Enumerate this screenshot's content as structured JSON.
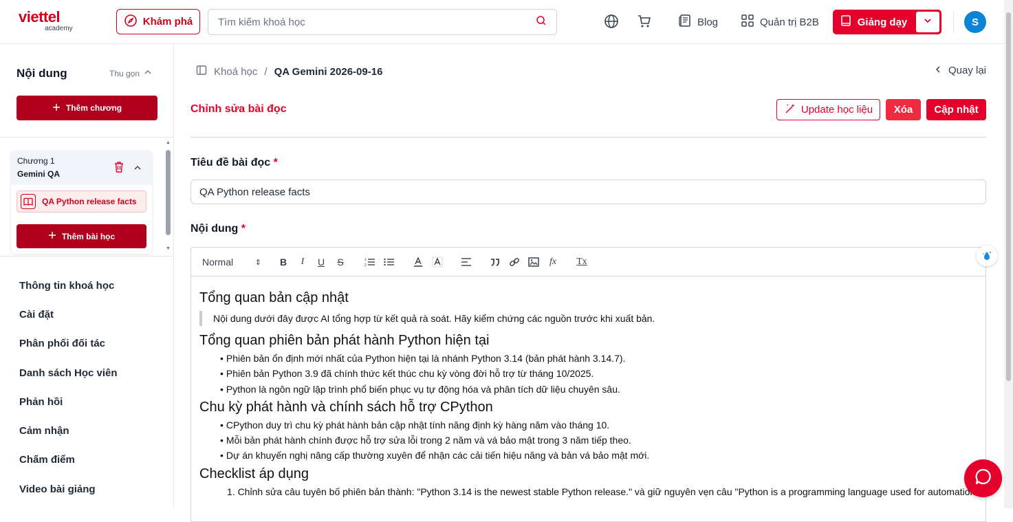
{
  "header": {
    "logo_brand": "viettel",
    "logo_sub": "academy",
    "explore_label": "Khám phá",
    "search_placeholder": "Tìm kiếm khoá học",
    "blog_label": "Blog",
    "b2b_label": "Quản trị B2B",
    "teach_label": "Giảng dạy",
    "avatar_initial": "S",
    "colors": {
      "brand": "#e4002b",
      "avatar": "#0a84d6"
    }
  },
  "sidebar": {
    "title": "Nội dung",
    "collapse_label": "Thu gọn",
    "add_chapter_label": "Thêm chương",
    "chapter": {
      "line1": "Chương 1",
      "line2": "Gemini QA",
      "lesson_label": "QA Python release facts",
      "add_lesson_label": "Thêm bài học"
    },
    "menu": [
      "Thông tin khoá học",
      "Cài đặt",
      "Phân phối đối tác",
      "Danh sách Học viên",
      "Phản hồi",
      "Cảm nhận",
      "Chấm điểm",
      "Video bài giảng"
    ]
  },
  "main": {
    "breadcrumb": {
      "root": "Khoá học",
      "sep": "/",
      "current": "QA Gemini 2026-09-16"
    },
    "back_label": "Quay lại",
    "page_title": "Chỉnh sửa bài đọc",
    "buttons": {
      "update_material": "Update học liệu",
      "delete": "Xóa",
      "save": "Cập nhật"
    },
    "title_field": {
      "label": "Tiêu đề bài đọc",
      "required_mark": "*",
      "value": "QA Python release facts"
    },
    "content_field": {
      "label": "Nội dung",
      "required_mark": "*"
    },
    "toolbar": {
      "format_select": "Normal",
      "select_arrow": "⇕",
      "fx": "fx",
      "clear": "Tx"
    },
    "document": {
      "h1": "Tổng quan bản cập nhật",
      "quote": "Nội dung dưới đây được AI tổng hợp từ kết quả rà soát. Hãy kiểm chứng các nguồn trước khi xuất bản.",
      "h2": "Tổng quan phiên bản phát hành Python hiện tại",
      "list1": [
        "Phiên bản ổn định mới nhất của Python hiện tại là nhánh Python 3.14 (bản phát hành 3.14.7).",
        "Phiên bản Python 3.9 đã chính thức kết thúc chu kỳ vòng đời hỗ trợ từ tháng 10/2025.",
        "Python là ngôn ngữ lập trình phổ biến phục vụ tự động hóa và phân tích dữ liệu chuyên sâu."
      ],
      "h3": "Chu kỳ phát hành và chính sách hỗ trợ CPython",
      "list2": [
        "CPython duy trì chu kỳ phát hành bản cập nhật tính năng định kỳ hàng năm vào tháng 10.",
        "Mỗi bản phát hành chính được hỗ trợ sửa lỗi trong 2 năm và vá bảo mật trong 3 năm tiếp theo.",
        "Dự án khuyến nghị nâng cấp thường xuyên để nhận các cải tiến hiệu năng và bản vá bảo mật mới."
      ],
      "h4": "Checklist áp dụng",
      "olist": [
        "1. Chỉnh sửa câu tuyên bố phiên bản thành: \"Python 3.14 is the newest stable Python release.\" và giữ nguyên vẹn câu \"Python is a programming language used for automation and"
      ]
    }
  }
}
